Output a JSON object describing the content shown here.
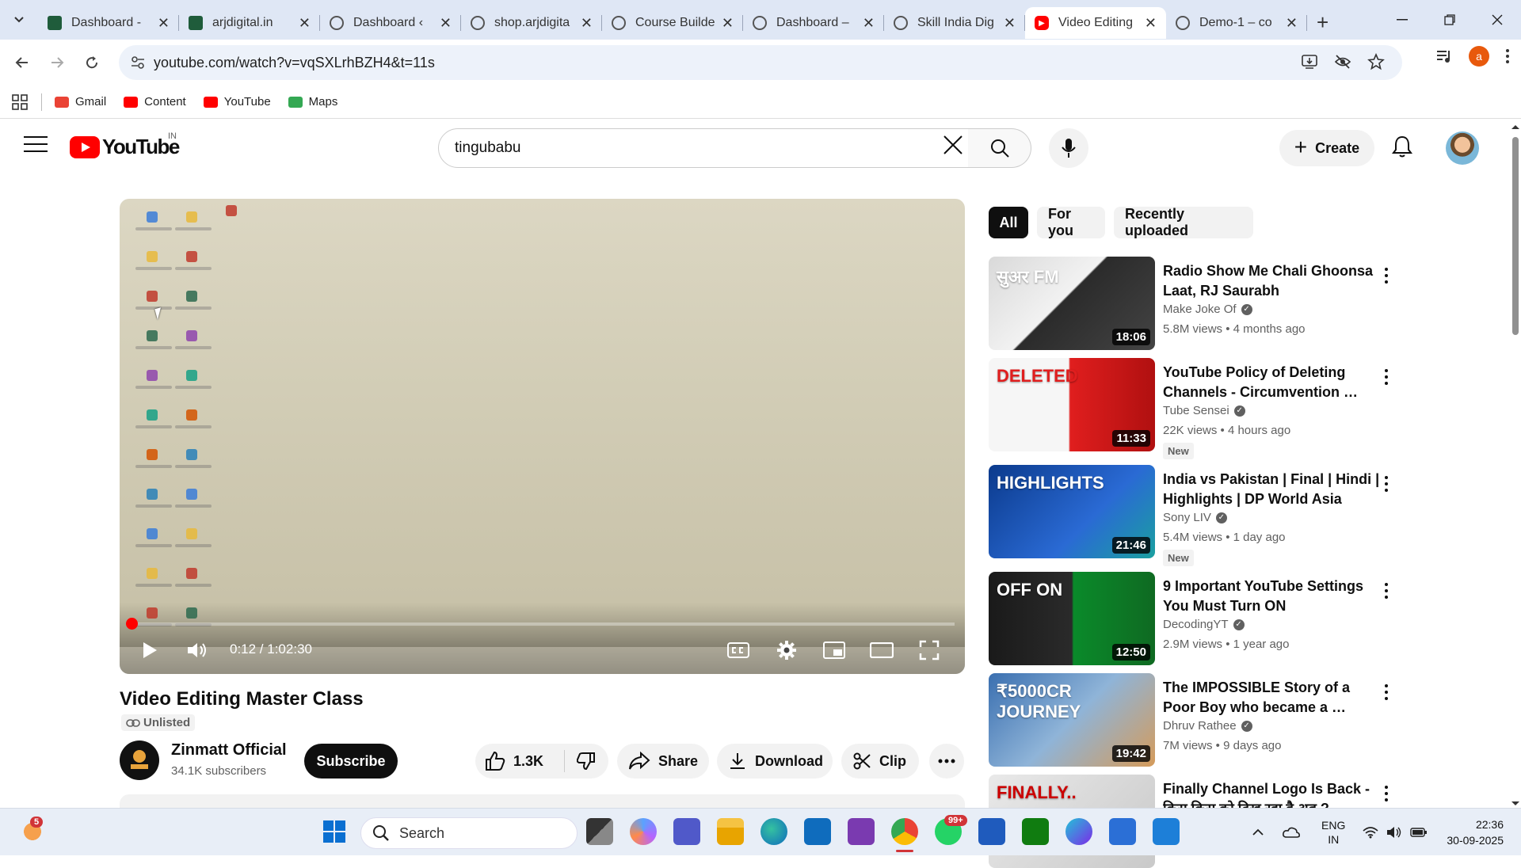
{
  "browser": {
    "tabs": [
      {
        "title": "Dashboard - ",
        "favicon": "green-square-icon"
      },
      {
        "title": "arjdigital.in",
        "favicon": "green-square-icon"
      },
      {
        "title": "Dashboard ‹ ",
        "favicon": "globe-icon"
      },
      {
        "title": "shop.arjdigita",
        "favicon": "globe-icon"
      },
      {
        "title": "Course Builde",
        "favicon": "globe-icon"
      },
      {
        "title": "Dashboard – ",
        "favicon": "globe-icon"
      },
      {
        "title": "Skill India Dig",
        "favicon": "globe-icon"
      },
      {
        "title": "Video Editing",
        "favicon": "youtube-icon",
        "active": true
      },
      {
        "title": "Demo-1 – co",
        "favicon": "globe-icon"
      }
    ],
    "url": "youtube.com/watch?v=vqSXLrhBZH4&t=11s",
    "profile_initial": "a",
    "bookmarks": [
      {
        "label": "Gmail",
        "color": "#ea4335"
      },
      {
        "label": "Content",
        "color": "#ff0000"
      },
      {
        "label": "YouTube",
        "color": "#ff0000"
      },
      {
        "label": "Maps",
        "color": "#34a853"
      }
    ]
  },
  "youtube": {
    "logo_text": "YouTube",
    "country_code": "IN",
    "search_value": "tingubabu",
    "create_label": "Create",
    "chips": [
      "All",
      "For you",
      "Recently uploaded"
    ]
  },
  "player": {
    "time": "0:12 / 1:02:30",
    "progress": 0.0032,
    "volume_state": "on"
  },
  "video": {
    "title": "Video Editing Master Class",
    "visibility": "Unlisted",
    "channel": "Zinmatt Official",
    "subscribers": "34.1K subscribers",
    "subscribe_label": "Subscribe",
    "likes": "1.3K",
    "share_label": "Share",
    "download_label": "Download",
    "clip_label": "Clip"
  },
  "recommendations": [
    {
      "title": "Radio Show Me Chali Ghoonsa Laat, RJ Saurabh",
      "channel": "Make Joke Of",
      "meta": "5.8M views • 4 months ago",
      "duration": "18:06",
      "new": "",
      "thumb_text": "सुअर FM"
    },
    {
      "title": "YouTube Policy of Deleting Channels - Circumvention …",
      "channel": "Tube Sensei",
      "meta": "22K views • 4 hours ago",
      "duration": "11:33",
      "new": "New",
      "thumb_text": "DELETED"
    },
    {
      "title": "India vs Pakistan | Final | Hindi | Highlights | DP World Asia Cup…",
      "channel": "Sony LIV",
      "meta": "5.4M views • 1 day ago",
      "duration": "21:46",
      "new": "New",
      "thumb_text": "HIGHLIGHTS"
    },
    {
      "title": "9 Important YouTube Settings You Must Turn ON",
      "channel": "DecodingYT",
      "meta": "2.9M views • 1 year ago",
      "duration": "12:50",
      "new": "",
      "thumb_text": "OFF ON"
    },
    {
      "title": "The IMPOSSIBLE Story of a Poor Boy who became a …",
      "channel": "Dhruv Rathee",
      "meta": "7M views • 9 days ago",
      "duration": "19:42",
      "new": "",
      "thumb_text": "₹5000CR JOURNEY"
    },
    {
      "title": "Finally Channel Logo Is Back - किस किस को दिख रहा है अब ?",
      "channel": "",
      "meta": "",
      "duration": "",
      "new": "",
      "thumb_text": "FINALLY.."
    }
  ],
  "taskbar": {
    "search_placeholder": "Search",
    "widgets_badge": "5",
    "whatsapp_badge": "99+",
    "lang_top": "ENG",
    "lang_bottom": "IN",
    "time": "22:36",
    "date": "30-09-2025"
  }
}
